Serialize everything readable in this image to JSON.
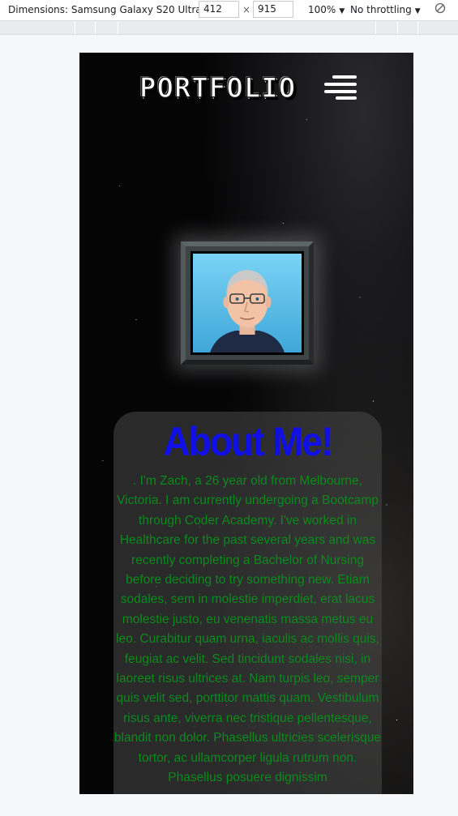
{
  "devtools": {
    "device_label": "Dimensions: Samsung Galaxy S20 Ultra",
    "width_value": "412",
    "times": "×",
    "height_value": "915",
    "zoom_label": "100%",
    "throttle_label": "No throttling",
    "icons": {
      "device_dropdown": "caret-down-icon",
      "zoom_dropdown": "caret-down-icon",
      "throttle_dropdown": "caret-down-icon",
      "rotate": "rotate-icon"
    }
  },
  "site": {
    "logo": "PORTFOLIO",
    "menu_icon": "hamburger-menu-icon",
    "portrait_alt": "Cartoon portrait of Zach",
    "about": {
      "title": "About Me!",
      "body": ". I'm Zach, a 26 year old from Melbourne, Victoria. I am currently undergoing a Bootcamp through Coder Academy. I've worked in Healthcare for the past several years and was recently completing a Bachelor of Nursing before deciding to try something new. Etiam sodales, sem in molestie imperdiet, erat lacus molestie justo, eu venenatis massa metus eu leo. Curabitur quam urna, iaculis ac mollis quis, feugiat ac velit. Sed tincidunt sodales nisi, in laoreet risus ultrices at. Nam turpis leo, semper quis velit sed, porttitor mattis quam. Vestibulum risus ante, viverra nec tristique pellentesque, blandit non dolor. Phasellus ultricies scelerisque tortor, ac ullamcorper ligula rutrum non. Phasellus posuere dignissim"
    },
    "colors": {
      "title": "#1010e6",
      "body_text": "#0b8a1c",
      "background": "#050506"
    }
  }
}
